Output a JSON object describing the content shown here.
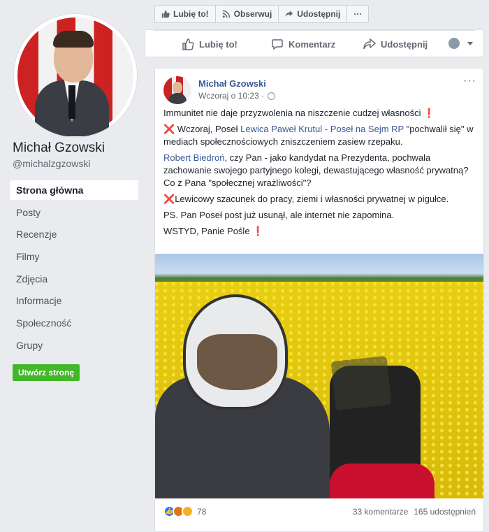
{
  "profile": {
    "name": "Michał Gzowski",
    "handle": "@michalzgzowski"
  },
  "nav": {
    "items": [
      {
        "label": "Strona główna",
        "active": true
      },
      {
        "label": "Posty"
      },
      {
        "label": "Recenzje"
      },
      {
        "label": "Filmy"
      },
      {
        "label": "Zdjęcia"
      },
      {
        "label": "Informacje"
      },
      {
        "label": "Społeczność"
      },
      {
        "label": "Grupy"
      }
    ],
    "create_page": "Utwórz stronę"
  },
  "toolbar": {
    "like": "Lubię to!",
    "follow": "Obserwuj",
    "share": "Udostępnij",
    "more": "···"
  },
  "actions": {
    "like": "Lubię to!",
    "comment": "Komentarz",
    "share": "Udostępnij"
  },
  "post": {
    "author": "Michał Gzowski",
    "time": "Wczoraj o 10:23 ·",
    "more": "···",
    "line1_text": "Immunitet nie daje przyzwolenia na niszczenie cudzej własności ",
    "line1_mark": "❗",
    "p2_mark": "❌",
    "p2_a": " Wczoraj, Poseł ",
    "p2_link": "Lewica Paweł Krutul - Poseł na Sejm RP",
    "p2_b": " \"pochwalił się\" w mediach społecznościowych zniszczeniem zasiew rzepaku.",
    "p3_link": "Robert Biedroń",
    "p3_text": ", czy Pan - jako kandydat na Prezydenta, pochwala zachowanie swojego partyjnego kolegi, dewastującego własność prywatną? Co z Pana \"społecznej wrażliwości\"?",
    "p4_mark": "❌",
    "p4_text": "Lewicowy szacunek do pracy, ziemi i własności prywatnej w pigułce.",
    "p5_text": "PS. Pan Poseł post już usunął, ale internet nie zapomina.",
    "p6_text": "WSTYD, Panie Pośle ",
    "p6_mark": "❗",
    "reaction_count": "78",
    "comments": "33 komentarze",
    "shares": "165 udostępnień"
  },
  "colors": {
    "link": "#385898",
    "create_button": "#42b72a",
    "like_reaction": "#2078f4"
  },
  "icons": [
    "like-thumb-icon",
    "rss-icon",
    "share-arrow-icon",
    "comment-bubble-icon",
    "globe-icon",
    "caret-down-icon"
  ]
}
